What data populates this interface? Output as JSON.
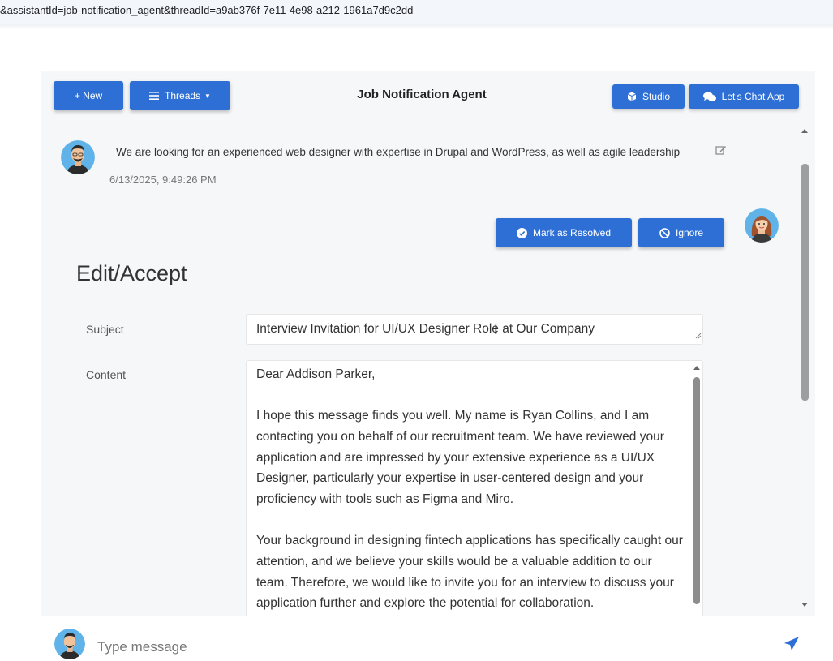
{
  "browser": {
    "url_fragment": "&assistantId=job-notification_agent&threadId=a9ab376f-7e11-4e98-a212-1961a7d9c2dd"
  },
  "header": {
    "new_label": "+ New",
    "threads_label": "Threads",
    "title": "Job Notification Agent",
    "studio_label": "Studio",
    "chat_app_label": "Let's Chat App"
  },
  "message": {
    "text": "We are looking for an experienced web designer with expertise in Drupal and WordPress, as well as agile leadership",
    "timestamp": "6/13/2025, 9:49:26 PM"
  },
  "actions": {
    "resolve_label": "Mark as Resolved",
    "ignore_label": "Ignore"
  },
  "form": {
    "heading": "Edit/Accept",
    "subject_label": "Subject",
    "subject_value": "Interview Invitation for UI/UX Designer Role at Our Company",
    "content_label": "Content",
    "content_paragraphs": [
      "Dear Addison Parker,",
      "I hope this message finds you well. My name is Ryan Collins, and I am contacting you on behalf of our recruitment team. We have reviewed your application and are impressed by your extensive experience as a UI/UX Designer, particularly your expertise in user-centered design and your proficiency with tools such as Figma and Miro.",
      "Your background in designing fintech applications has specifically caught our attention, and we believe your skills would be a valuable addition to our team. Therefore, we would like to invite you for an interview to discuss your application further and explore the potential for collaboration."
    ]
  },
  "composer": {
    "placeholder": "Type message"
  },
  "colors": {
    "accent": "#2e6fd6",
    "panel": "#f6f7f9"
  }
}
